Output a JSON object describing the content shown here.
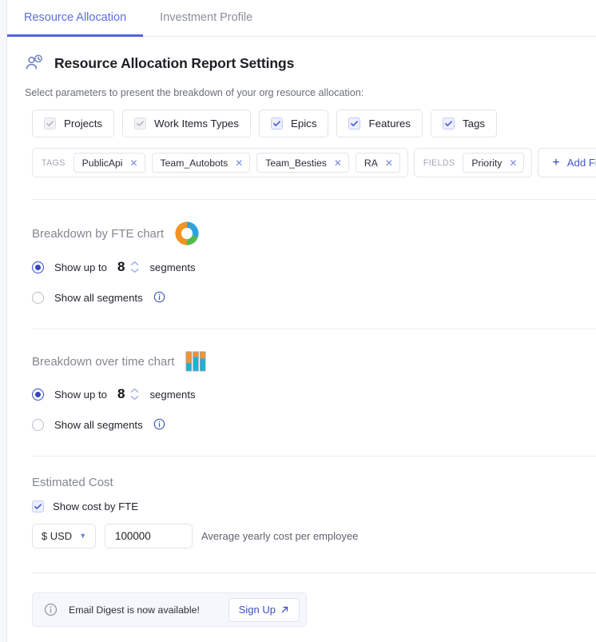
{
  "tabs": [
    {
      "label": "Resource Allocation",
      "active": true
    },
    {
      "label": "Investment Profile",
      "active": false
    }
  ],
  "header": {
    "icon": "people-time-icon",
    "title": "Resource Allocation Report Settings",
    "subtitle": "Select parameters to present the breakdown of your org resource allocation:"
  },
  "parameters": [
    {
      "label": "Projects",
      "checked": true,
      "state": "disabled"
    },
    {
      "label": "Work Items Types",
      "checked": true,
      "state": "disabled"
    },
    {
      "label": "Epics",
      "checked": true,
      "state": "enabled"
    },
    {
      "label": "Features",
      "checked": true,
      "state": "enabled"
    },
    {
      "label": "Tags",
      "checked": true,
      "state": "enabled"
    }
  ],
  "filters": {
    "groups": [
      {
        "label": "TAGS",
        "chips": [
          "PublicApi",
          "Team_Autobots",
          "Team_Besties",
          "RA"
        ]
      },
      {
        "label": "FIELDS",
        "chips": [
          "Priority"
        ]
      }
    ],
    "add_button": "Add Filter",
    "remove_icon": "close-icon",
    "add_icon": "plus-icon"
  },
  "fte_chart": {
    "title": "Breakdown by FTE chart",
    "icon": "donut-chart-icon",
    "option_limit_prefix": "Show up to",
    "option_limit_suffix": "segments",
    "segments_value": "8",
    "option_all": "Show all segments",
    "selected": "limit",
    "info_icon": "info-icon",
    "stepper_up_icon": "chevron-up-icon",
    "stepper_down_icon": "chevron-down-icon"
  },
  "time_chart": {
    "title": "Breakdown over time chart",
    "icon": "bar-chart-icon",
    "option_limit_prefix": "Show up to",
    "option_limit_suffix": "segments",
    "segments_value": "8",
    "option_all": "Show all segments",
    "selected": "limit",
    "info_icon": "info-icon",
    "stepper_up_icon": "chevron-up-icon",
    "stepper_down_icon": "chevron-down-icon"
  },
  "estimated_cost": {
    "title": "Estimated Cost",
    "show_cost_label": "Show cost by FTE",
    "show_cost_checked": true,
    "currency": "$ USD",
    "currency_caret_icon": "chevron-down-icon",
    "amount": "100000",
    "hint": "Average yearly cost per employee"
  },
  "banner": {
    "info_icon": "info-icon",
    "text": "Email Digest is now available!",
    "button": "Sign Up",
    "button_icon": "external-link-arrow-icon"
  },
  "colors": {
    "accent": "#5162e0",
    "accent_text": "#5b6ee0",
    "radio_on": "#3347c4",
    "donut_orange": "#f3931f",
    "donut_blue": "#2ca3e0",
    "donut_green": "#54b84f",
    "bar_orange": "#f7922d",
    "bar_cyan": "#17b5cf",
    "banner_bg": "#f6f7fd"
  },
  "chart_icons": {
    "donut": {
      "type": "pie",
      "slices": [
        {
          "name": "orange",
          "value": 50,
          "color": "#f3931f"
        },
        {
          "name": "blue",
          "value": 30,
          "color": "#2ca3e0"
        },
        {
          "name": "green",
          "value": 20,
          "color": "#54b84f"
        }
      ]
    },
    "bars": {
      "type": "bar",
      "categories": [
        "1",
        "2",
        "3"
      ],
      "series": [
        {
          "name": "orange",
          "values": [
            58,
            26,
            34
          ],
          "color": "#f7922d"
        },
        {
          "name": "cyan",
          "values": [
            42,
            74,
            66
          ],
          "color": "#17b5cf"
        }
      ],
      "stacked": true
    }
  }
}
